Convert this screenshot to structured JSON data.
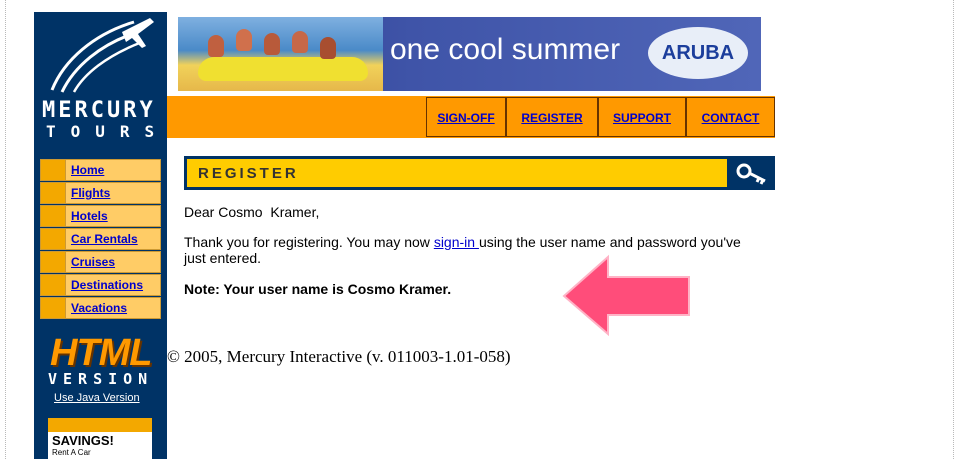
{
  "brand": {
    "name_line1": "MERCURY",
    "name_line2": "TOURS",
    "html_version": "HTML",
    "version_label": "VERSION",
    "java_link": "Use Java Version",
    "ad_title": "SAVINGS!",
    "ad_sub": "Rent A Car"
  },
  "sidebar": {
    "items": [
      {
        "label": "Home"
      },
      {
        "label": "Flights"
      },
      {
        "label": "Hotels"
      },
      {
        "label": "Car Rentals"
      },
      {
        "label": "Cruises"
      },
      {
        "label": "Destinations"
      },
      {
        "label": "Vacations"
      }
    ]
  },
  "banner": {
    "title": "one cool summer",
    "logo": "ARUBA"
  },
  "topnav": {
    "items": [
      {
        "label": "SIGN-OFF"
      },
      {
        "label": "REGISTER"
      },
      {
        "label": "SUPPORT"
      },
      {
        "label": "CONTACT"
      }
    ]
  },
  "page": {
    "section_title": "REGISTER",
    "greeting": "Dear Cosmo  Kramer,",
    "thanks_pre": "Thank you for registering. You may now ",
    "signin_link": "sign-in ",
    "thanks_post": "using the user name and password you've just entered.",
    "note": "Note: Your user name is Cosmo Kramer.",
    "copyright": "© 2005, Mercury Interactive (v. 011003-1.01-058)"
  },
  "colors": {
    "navy": "#003366",
    "orange": "#ff9900",
    "yellow": "#ffcc00",
    "link": "#0000cc",
    "arrow": "#ff4d7a"
  },
  "icons": [
    "plane-logo-icon",
    "key-icon",
    "arrow-annotation-icon"
  ]
}
